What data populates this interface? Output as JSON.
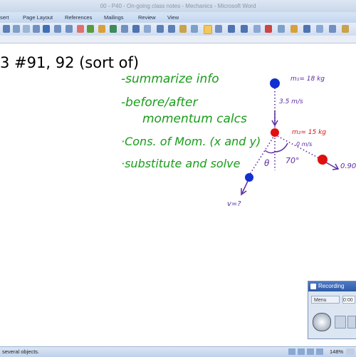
{
  "window": {
    "title": "00 - P40 - On-going class notes - Mechanics - Microsoft Word"
  },
  "ribbon": {
    "tabs": [
      "sert",
      "Page Layout",
      "References",
      "Mailings",
      "Review",
      "View"
    ]
  },
  "document": {
    "heading": "3 #91, 92 (sort of)",
    "list_items": [
      "-summarize info",
      "-before/after",
      "momentum calcs",
      "·Cons. of Mom. (x and y)",
      "·substitute and solve"
    ]
  },
  "diagram": {
    "m1_label": "m₁= 18 kg",
    "v1_label": "3.5 m/s",
    "m2_label": "m₂= 15 kg",
    "v2_label": "0 m/s",
    "angle_label": "70°",
    "theta_label": "θ",
    "v_label": "v=?",
    "right_label": "0.90",
    "colors": {
      "blue": "#1030d0",
      "red": "#e01010",
      "purple": "#5a2aa0"
    }
  },
  "status": {
    "text": "several objects.",
    "zoom": "148%"
  },
  "recording": {
    "title": "Recording",
    "menu_label": "Menu",
    "counter": "0:00"
  }
}
